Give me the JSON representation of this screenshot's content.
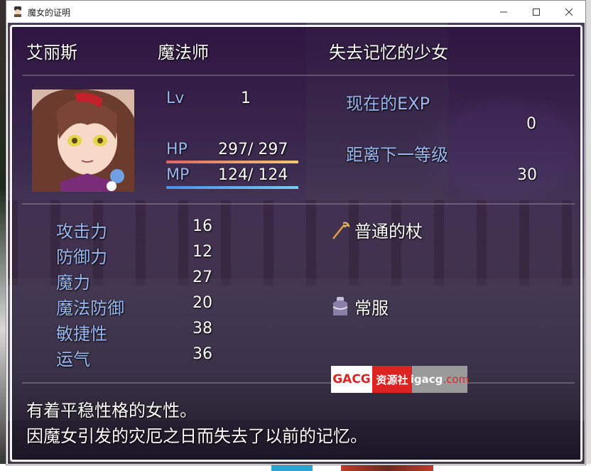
{
  "window": {
    "title": "魔女的证明"
  },
  "actor": {
    "name": "艾丽斯",
    "class": "魔法师",
    "nickname": "失去记忆的少女",
    "level_label": "Lv",
    "level": "1",
    "hp_label": "HP",
    "hp_value": "297/ 297",
    "hp_ratio": 1.0,
    "mp_label": "MP",
    "mp_value": "124/ 124",
    "mp_ratio": 1.0
  },
  "exp": {
    "current_label": "现在的EXP",
    "current_value": "0",
    "next_label": "距离下一等级",
    "next_value": "30"
  },
  "params": [
    {
      "label": "攻击力",
      "value": "16"
    },
    {
      "label": "防御力",
      "value": "12"
    },
    {
      "label": "魔力",
      "value": "27"
    },
    {
      "label": "魔法防御",
      "value": "20"
    },
    {
      "label": "敏捷性",
      "value": "38"
    },
    {
      "label": "运气",
      "value": "36"
    }
  ],
  "equipment": [
    {
      "icon": "staff-icon",
      "name": "普通的杖"
    },
    {
      "icon": "clothes-icon",
      "name": "常服"
    }
  ],
  "profile": {
    "line1": "有着平稳性格的女性。",
    "line2": "因魔女引发的灾厄之日而失去了以前的记忆。"
  },
  "watermark": {
    "part_a": "GACG",
    "part_b": "资源社",
    "part_c_main": "igacg",
    "part_c_dot": ".com"
  },
  "colors": {
    "system_text": "#9bb8f0",
    "hp_gauge": "#e06666",
    "mp_gauge": "#4c8fe8"
  }
}
